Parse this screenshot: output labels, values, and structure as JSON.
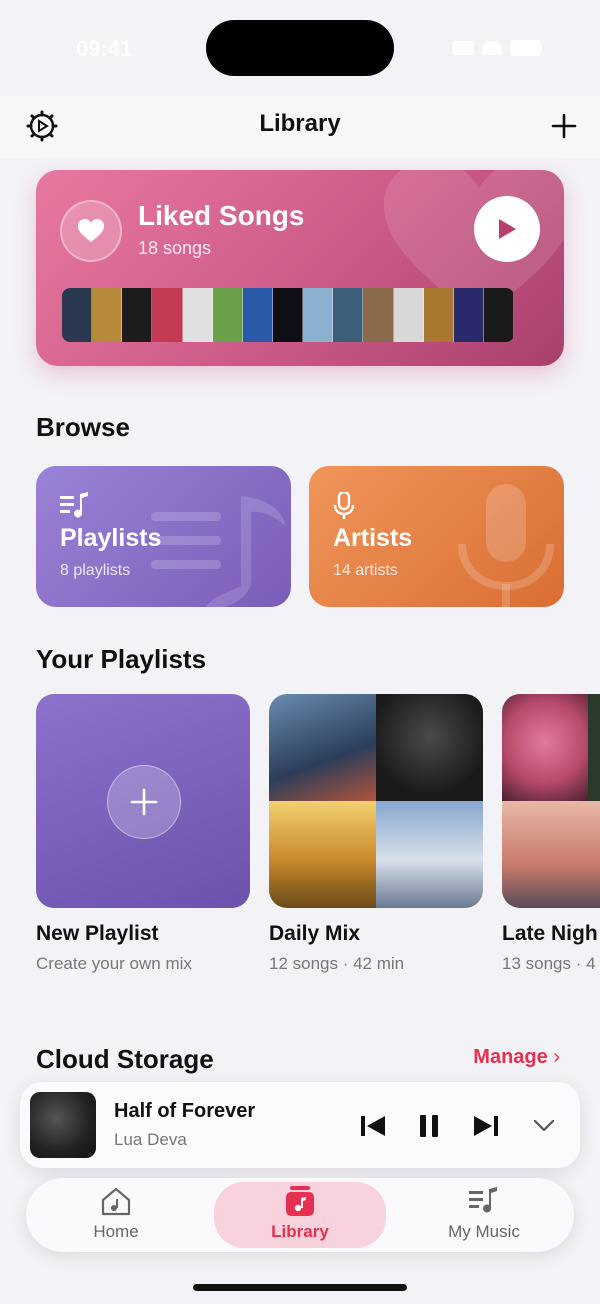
{
  "status": {
    "time": "09:41"
  },
  "header": {
    "title": "Library",
    "settings_icon": "gear-icon",
    "add_icon": "plus-icon"
  },
  "liked": {
    "title": "Liked Songs",
    "count": "18 songs",
    "accent": "#d0588a",
    "thumbs": [
      "#2a3950",
      "#b78a3a",
      "#1c1c1c",
      "#c23a54",
      "#e0e0e0",
      "#6aa04a",
      "#2a5aa8",
      "#0e0e14",
      "#8ab0d0",
      "#3c5e7a",
      "#8a6a4a",
      "#d8d8d8",
      "#a87830",
      "#2a2a6a",
      "#1a1a1a"
    ]
  },
  "browse": {
    "title": "Browse",
    "playlists": {
      "title": "Playlists",
      "sub": "8 playlists"
    },
    "artists": {
      "title": "Artists",
      "sub": "14 artists"
    }
  },
  "your_playlists": {
    "title": "Your Playlists",
    "items": [
      {
        "name": "New Playlist",
        "meta": "Create your own mix"
      },
      {
        "name": "Daily Mix",
        "meta": "12 songs · 42 min"
      },
      {
        "name": "Late Nigh",
        "meta": "13 songs · 4"
      }
    ]
  },
  "cloud": {
    "title": "Cloud Storage",
    "manage": "Manage"
  },
  "now_playing": {
    "title": "Half of Forever",
    "artist": "Lua Deva"
  },
  "tabs": [
    {
      "label": "Home",
      "icon": "home-icon"
    },
    {
      "label": "Library",
      "icon": "library-icon"
    },
    {
      "label": "My Music",
      "icon": "music-list-icon"
    }
  ]
}
